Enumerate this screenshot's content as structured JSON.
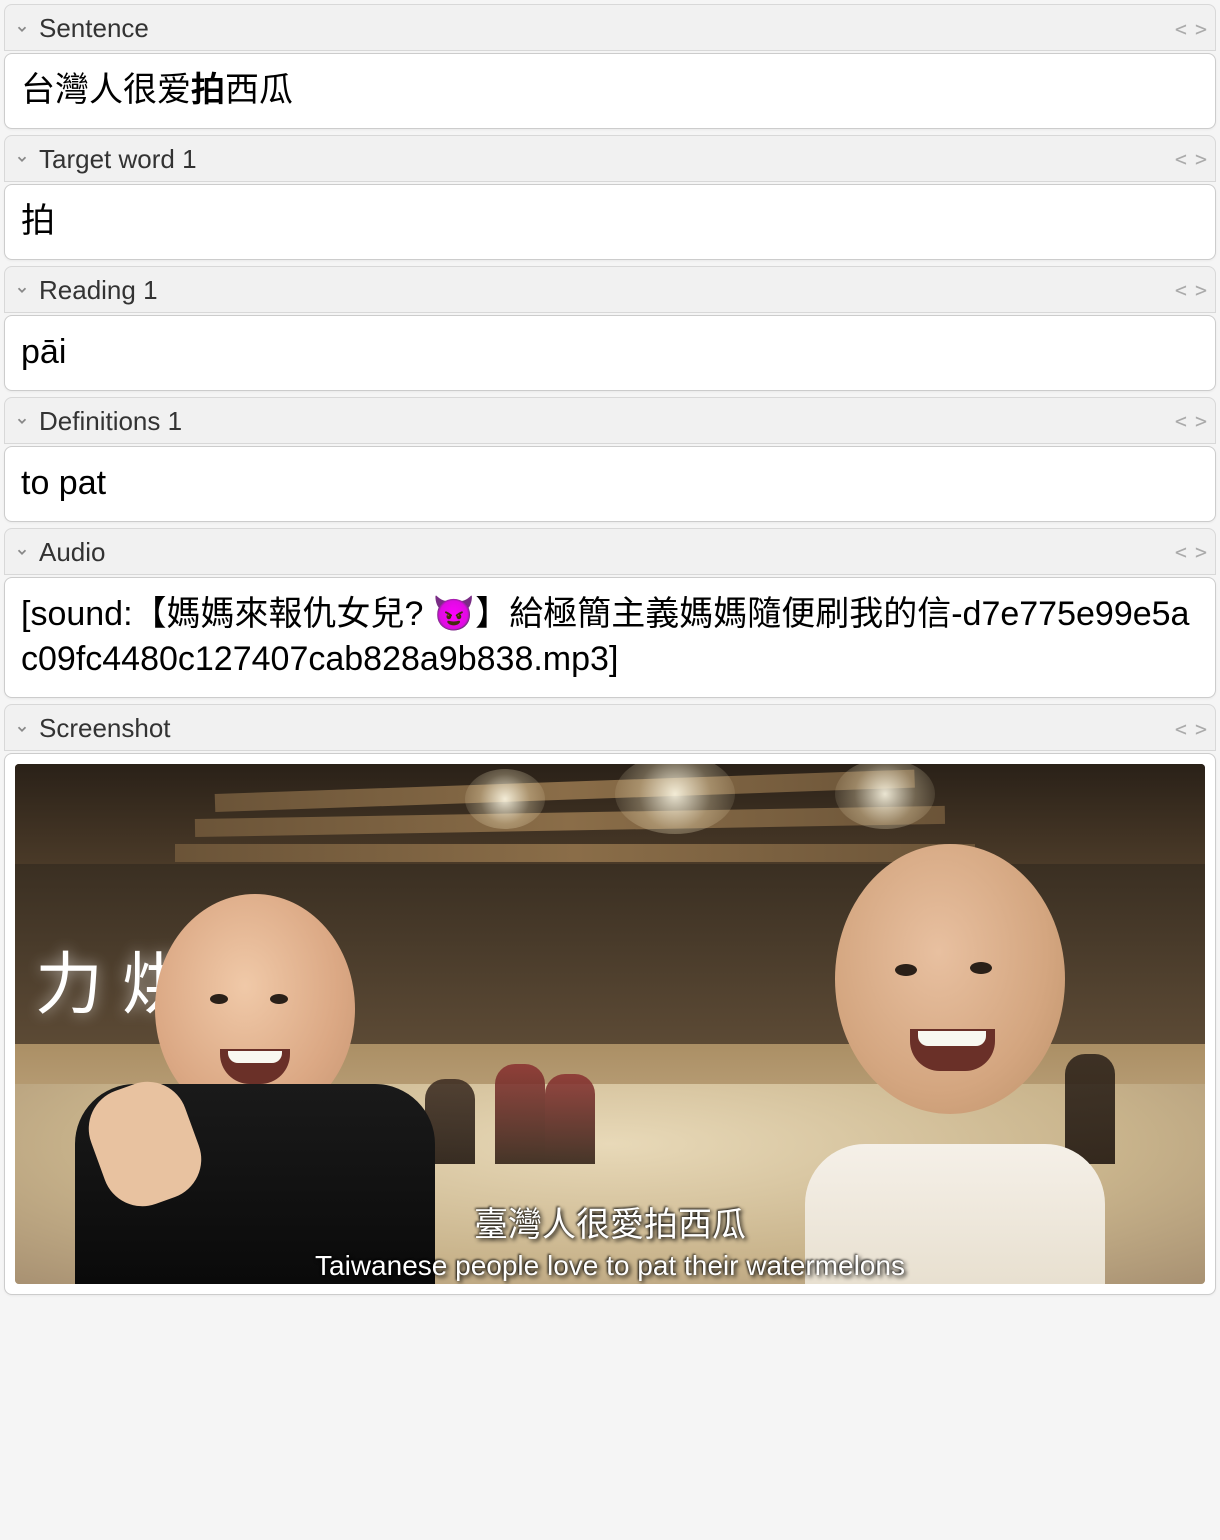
{
  "fields": [
    {
      "label": "Sentence",
      "content_pre": "台灣人很爱",
      "content_bold": "拍",
      "content_post": "西瓜"
    },
    {
      "label": "Target word 1",
      "content": "拍"
    },
    {
      "label": "Reading 1",
      "content": "pāi"
    },
    {
      "label": "Definitions 1",
      "content": "to pat"
    },
    {
      "label": "Audio",
      "content": "[sound:【媽媽來報仇女兒? 😈】給極簡主義媽媽隨便刷我的信-d7e775e99e5ac09fc4480c127407cab828a9b838.mp3]"
    },
    {
      "label": "Screenshot",
      "type": "image"
    }
  ],
  "screenshot": {
    "sign_text": "力 烘 焙",
    "subtitle_cn": "臺灣人很愛拍西瓜",
    "subtitle_en": "Taiwanese people love to pat their watermelons"
  }
}
